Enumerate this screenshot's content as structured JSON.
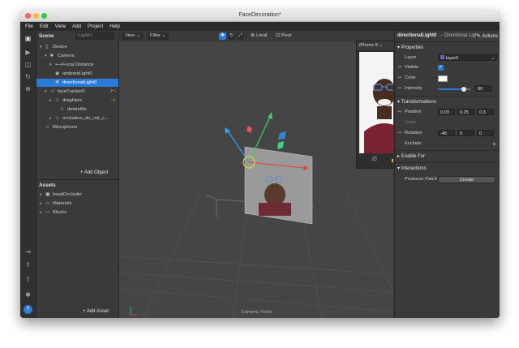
{
  "window": {
    "title": "FaceDecoration*"
  },
  "menu": [
    "File",
    "Edit",
    "View",
    "Add",
    "Project",
    "Help"
  ],
  "left_toolbar": {
    "icons": [
      "scene-icon",
      "video-icon",
      "layout-icon",
      "refresh-icon",
      "zoom-icon",
      "import-icon",
      "export-icon",
      "upload-icon",
      "folder-icon",
      "bug-icon"
    ],
    "help_label": "?"
  },
  "scene": {
    "title": "Scene",
    "layers_tab": "Layers",
    "items": [
      {
        "label": "Device",
        "caret": "▾",
        "icon": "▯",
        "badge": ""
      },
      {
        "label": "Camera",
        "caret": "▾",
        "icon": "■",
        "badge": ""
      },
      {
        "label": "Focal Distance",
        "caret": "▾",
        "icon": "⟷",
        "badge": ""
      },
      {
        "label": "ambientLight0",
        "caret": "",
        "icon": "◉",
        "badge": ""
      },
      {
        "label": "directionalLight0",
        "caret": "",
        "icon": "✺",
        "badge": ""
      },
      {
        "label": "faceTracker0",
        "caret": "▾",
        "icon": "☺",
        "badge": "⊢›"
      },
      {
        "label": "dragHere",
        "caret": "▸",
        "icon": "⊹",
        "badge": "⊣›"
      },
      {
        "label": "deleteMe",
        "caret": "",
        "icon": "⊹",
        "badge": ""
      },
      {
        "label": "occluders_do_not_c...",
        "caret": "▸",
        "icon": "⊹",
        "badge": ""
      },
      {
        "label": "Microphone",
        "caret": "",
        "icon": "♫",
        "badge": ""
      }
    ],
    "add_object": "+ Add Object"
  },
  "assets": {
    "title": "Assets",
    "items": [
      {
        "label": "headOccluder",
        "caret": "▸",
        "icon": "▣"
      },
      {
        "label": "Materials",
        "caret": "▸",
        "icon": "▭"
      },
      {
        "label": "Blocks",
        "caret": "▸",
        "icon": "▭"
      }
    ],
    "add_asset": "+ Add Asset"
  },
  "viewport": {
    "view_button": "View ⌄",
    "filter_button": "Filter ⌄",
    "local_label": "Local",
    "pivot_label": "Pivot",
    "camera_label": "Camera: Front"
  },
  "simulator": {
    "device": "iPhone 8 ⌄",
    "menu": "≡"
  },
  "properties": {
    "title": "directionalLight0",
    "parent": "– Directional Ligh",
    "actions": "Actions",
    "sections": {
      "properties": "▾  Properties",
      "transformations": "▾  Transformations",
      "exclude": "Exclude",
      "enable_for": "▸  Enable For",
      "interactions": "▾  Interactions"
    },
    "layer": {
      "label": "Layer",
      "value": "layer0"
    },
    "visible": {
      "label": "Visible",
      "checked": true
    },
    "color": {
      "label": "Color",
      "value": "#ffffff"
    },
    "intensity": {
      "label": "Intensity",
      "value": "80",
      "fraction": 0.8
    },
    "position": {
      "label": "Position",
      "x": "0.03",
      "y": "0.25",
      "z": "0.3"
    },
    "scale": {
      "label": "Scale"
    },
    "rotation": {
      "label": "Rotation",
      "x": "-45",
      "y": "5",
      "z": "0"
    },
    "exclude_add": "+",
    "producer_patch": {
      "label": "Producer Patch",
      "button": "Create"
    }
  },
  "colors": {
    "accent": "#2a7bd8",
    "panel": "#3a3a3a",
    "viewport": "#454545"
  }
}
